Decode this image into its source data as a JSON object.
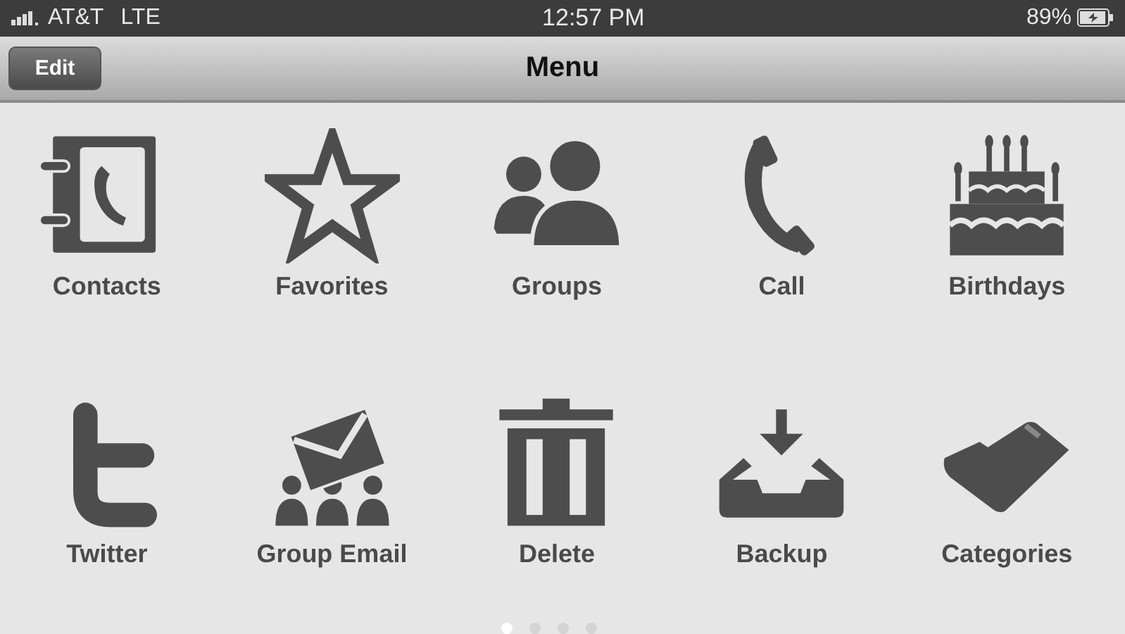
{
  "status_bar": {
    "carrier": "AT&T",
    "network": "LTE",
    "time": "12:57 PM",
    "battery": "89%"
  },
  "nav_bar": {
    "title": "Menu",
    "edit_button": "Edit"
  },
  "items": [
    {
      "label": "Contacts",
      "kind": "address-book"
    },
    {
      "label": "Favorites",
      "kind": "star"
    },
    {
      "label": "Groups",
      "kind": "people"
    },
    {
      "label": "Call",
      "kind": "phone"
    },
    {
      "label": "Birthdays",
      "kind": "cake"
    },
    {
      "label": "Twitter",
      "kind": "letter-t"
    },
    {
      "label": "Group Email",
      "kind": "group-mail"
    },
    {
      "label": "Delete",
      "kind": "trash"
    },
    {
      "label": "Backup",
      "kind": "inbox"
    },
    {
      "label": "Categories",
      "kind": "folder"
    }
  ],
  "pages": [
    {
      "selected": true
    },
    {
      "selected": false
    },
    {
      "selected": false
    },
    {
      "selected": false
    }
  ]
}
